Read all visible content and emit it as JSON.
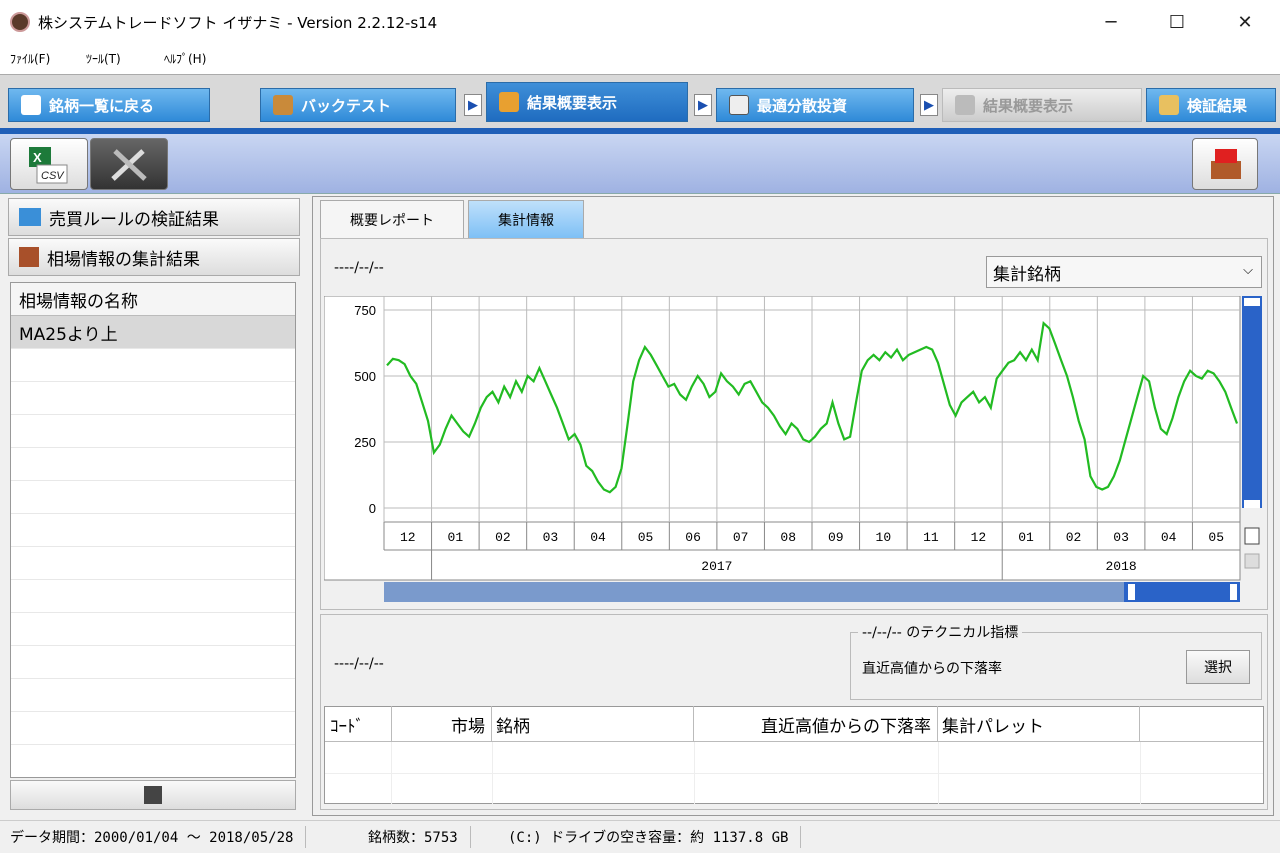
{
  "window": {
    "title": "株システムトレードソフト イザナミ - Version 2.2.12-s14"
  },
  "menu": [
    "ﾌｧｲﾙ(F)",
    "ﾂｰﾙ(T)",
    "ﾍﾙﾌﾟ(H)"
  ],
  "tabs": [
    {
      "label": "銘柄一覧に戻る"
    },
    {
      "label": "バックテスト"
    },
    {
      "label": "結果概要表示"
    },
    {
      "label": "最適分散投資"
    },
    {
      "label": "結果概要表示"
    },
    {
      "label": "検証結果"
    }
  ],
  "toolbar": {
    "csv_label": "CSV"
  },
  "left": {
    "rules_btn": "売買ルールの検証結果",
    "market_btn": "相場情報の集計結果",
    "list_header": "相場情報の名称",
    "items": [
      "MA25より上"
    ]
  },
  "subtabs": [
    "概要レポート",
    "集計情報"
  ],
  "chart_header": {
    "date": "----/--/--",
    "select_value": "集計銘柄"
  },
  "chart_data": {
    "type": "line",
    "color": "#22bb22",
    "ylim": [
      0,
      750
    ],
    "yticks": [
      "750",
      "500",
      "250",
      "0"
    ],
    "months": [
      "12",
      "01",
      "02",
      "03",
      "04",
      "05",
      "06",
      "07",
      "08",
      "09",
      "10",
      "11",
      "12",
      "01",
      "02",
      "03",
      "04",
      "05"
    ],
    "years": [
      "2017",
      "2018"
    ],
    "values": [
      540,
      565,
      560,
      545,
      500,
      470,
      400,
      330,
      210,
      240,
      300,
      350,
      320,
      290,
      270,
      320,
      380,
      420,
      440,
      400,
      460,
      420,
      480,
      440,
      500,
      480,
      530,
      480,
      430,
      380,
      320,
      260,
      280,
      240,
      160,
      140,
      100,
      70,
      60,
      80,
      150,
      310,
      480,
      560,
      610,
      580,
      540,
      500,
      460,
      470,
      430,
      410,
      460,
      500,
      470,
      420,
      440,
      510,
      480,
      460,
      430,
      470,
      480,
      440,
      400,
      380,
      350,
      310,
      280,
      320,
      300,
      260,
      250,
      270,
      300,
      320,
      400,
      320,
      260,
      270,
      400,
      520,
      560,
      580,
      560,
      590,
      570,
      600,
      560,
      580,
      590,
      600,
      610,
      600,
      550,
      470,
      390,
      350,
      400,
      420,
      440,
      400,
      420,
      380,
      490,
      520,
      550,
      560,
      590,
      560,
      600,
      560,
      700,
      680,
      620,
      560,
      500,
      420,
      330,
      260,
      120,
      80,
      70,
      80,
      120,
      180,
      260,
      340,
      420,
      500,
      480,
      380,
      300,
      280,
      340,
      420,
      480,
      520,
      500,
      490,
      520,
      510,
      480,
      440,
      380,
      320
    ],
    "range": [
      0,
      750
    ]
  },
  "lower": {
    "date": "----/--/--",
    "tech_group": "--/--/-- のテクニカル指標",
    "tech_value": "直近高値からの下落率",
    "select_btn": "選択"
  },
  "table": {
    "headers": [
      "ｺｰﾄﾞ",
      "市場",
      "銘柄",
      "直近高値からの下落率",
      "集計パレット"
    ]
  },
  "status": {
    "period": "データ期間：2000/01/04 〜 2018/05/28",
    "count": "銘柄数：5753",
    "disk": "(C:) ドライブの空き容量：約 1137.8 GB"
  }
}
